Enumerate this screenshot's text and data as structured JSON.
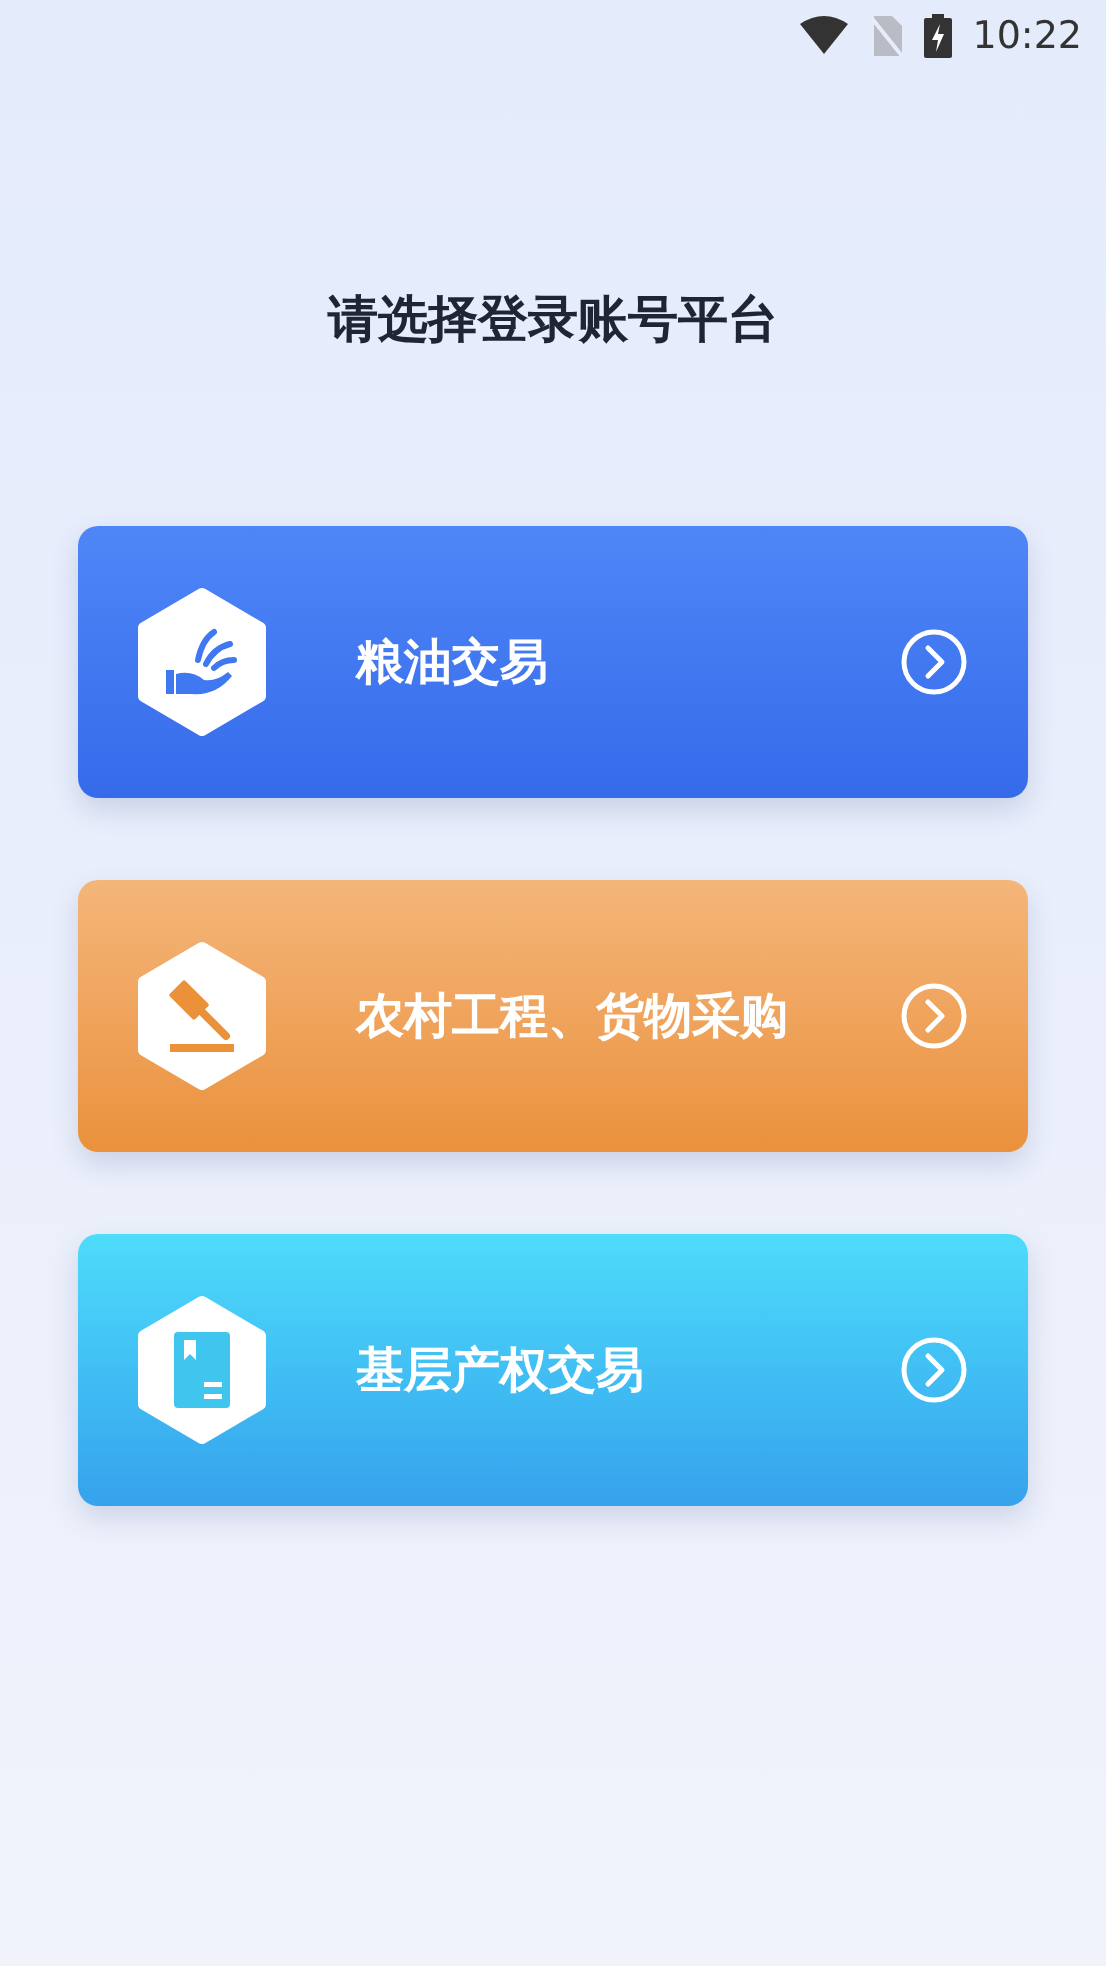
{
  "status_bar": {
    "time": "10:22"
  },
  "title": "请选择登录账号平台",
  "platforms": [
    {
      "kind": "grain",
      "label": "粮油交易"
    },
    {
      "kind": "gavel",
      "label": "农村工程、货物采购"
    },
    {
      "kind": "document",
      "label": "基层产权交易"
    }
  ]
}
